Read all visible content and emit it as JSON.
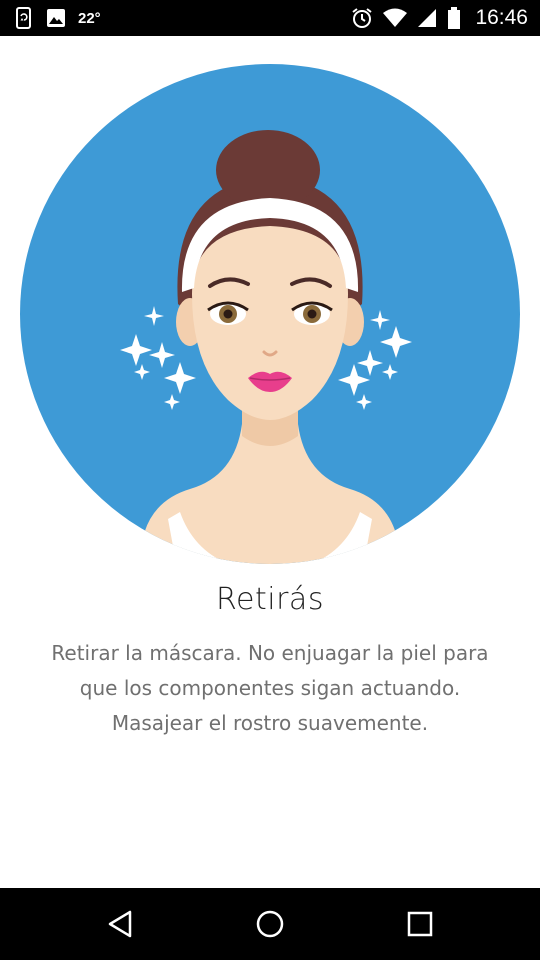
{
  "status_bar": {
    "left_icons": [
      "phone-sync-icon",
      "image-icon"
    ],
    "temperature": "22°",
    "right_icons": [
      "alarm-icon",
      "wifi-icon",
      "signal-icon",
      "battery-icon"
    ],
    "time": "16:46"
  },
  "main": {
    "illustration": {
      "circle_color": "#3e9ad6",
      "skin_color": "#f8dcc0",
      "hair_color": "#6b3a36"
    },
    "title": "Retirás",
    "description_lines": [
      "Retirar la máscara. No enjuagar la piel para",
      "que los componentes sigan actuando.",
      "Masajear el rostro suavemente."
    ]
  },
  "nav_bar": {
    "buttons": [
      "back-icon",
      "home-icon",
      "recents-icon"
    ]
  }
}
